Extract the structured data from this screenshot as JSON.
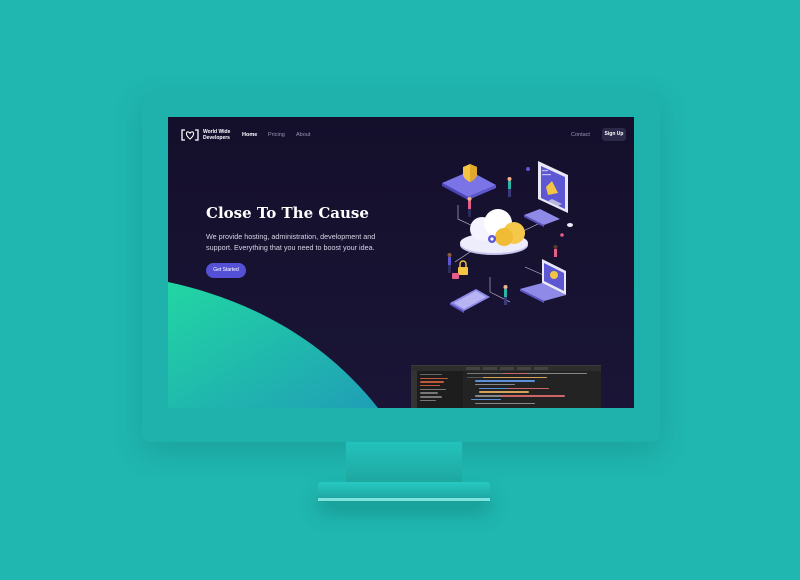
{
  "brand": {
    "name_line1": "World Wide",
    "name_line2": "Developers"
  },
  "nav": {
    "home": "Home",
    "pricing": "Pricing",
    "about": "About",
    "contact": "Contact",
    "signup": "Sign Up"
  },
  "hero": {
    "title": "Close To The Cause",
    "description": "We provide hosting, administration, development and support. Everything that you need to boost your idea.",
    "cta": "Get Started"
  },
  "colors": {
    "background": "#20b7b1",
    "screen": "#140f2b",
    "accent": "#5551d6",
    "wave_start": "#22d3a4",
    "wave_end": "#1fa9b3"
  },
  "icons": [
    "logo-icon",
    "cloud-icon",
    "monitor-icon",
    "phone-icon",
    "laptop-icon",
    "shield-icon",
    "lock-icon"
  ]
}
